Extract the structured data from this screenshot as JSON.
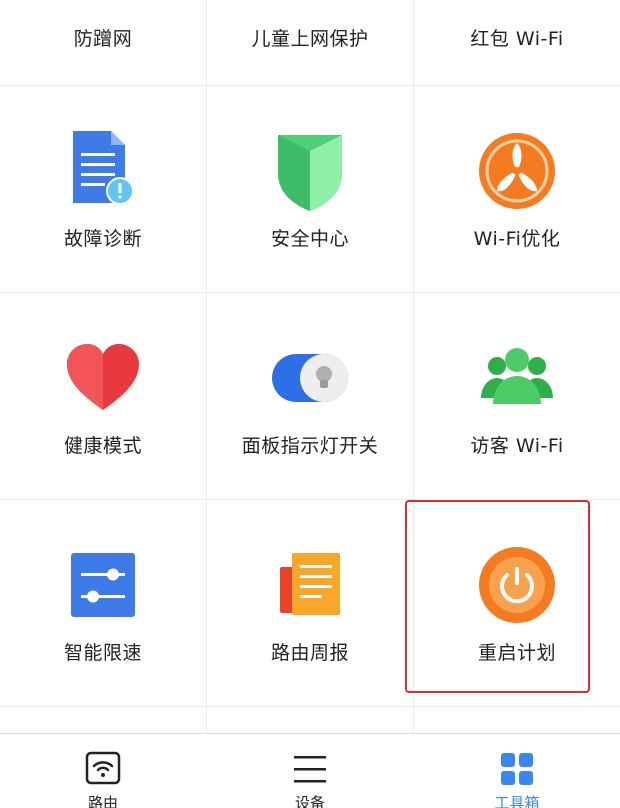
{
  "grid": {
    "row0": [
      "防蹭网",
      "儿童上网保护",
      "红包 Wi-Fi"
    ],
    "items": [
      {
        "label": "故障诊断"
      },
      {
        "label": "安全中心"
      },
      {
        "label": "Wi-Fi优化"
      },
      {
        "label": "健康模式"
      },
      {
        "label": "面板指示灯开关"
      },
      {
        "label": "访客 Wi-Fi"
      },
      {
        "label": "智能限速"
      },
      {
        "label": "路由周报"
      },
      {
        "label": "重启计划"
      }
    ]
  },
  "tabbar": {
    "tabs": [
      {
        "label": "路由",
        "icon": "wifi-router-icon"
      },
      {
        "label": "设备",
        "icon": "menu-list-icon"
      },
      {
        "label": "工具箱",
        "icon": "grid-tools-icon",
        "active": true
      }
    ]
  },
  "colors": {
    "accent_blue": "#3a86f3",
    "highlight_red": "#e02a2a",
    "orange": "#f57b20",
    "green": "#3cc45a",
    "heart_red": "#e8393e"
  }
}
